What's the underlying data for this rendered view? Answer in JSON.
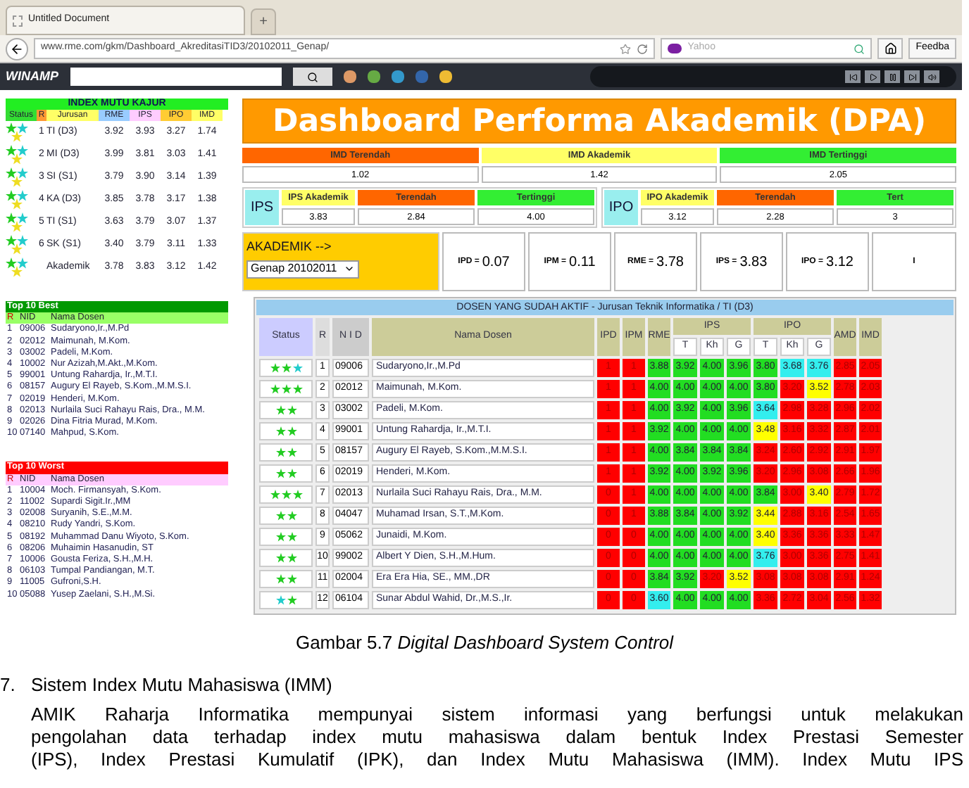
{
  "browser": {
    "tab_title": "Untitled Document",
    "new_tab": "+",
    "url": "www.rme.com/gkm/Dashboard_AkreditasiTID3/20102011_Genap/",
    "search_placeholder": "Yahoo",
    "feedback": "Feedba"
  },
  "toolbar": {
    "logo": "WINAMP"
  },
  "index_mutu": {
    "title": "INDEX MUTU KAJUR",
    "columns": [
      "Status",
      "R",
      "Jurusan",
      "RME",
      "IPS",
      "IPO",
      "IMD"
    ],
    "rows": [
      {
        "rank": "1",
        "jurusan": "TI (D3)",
        "values": [
          "3.92",
          "3.93",
          "3.27",
          "1.74"
        ]
      },
      {
        "rank": "2",
        "jurusan": "MI (D3)",
        "values": [
          "3.99",
          "3.81",
          "3.03",
          "1.41"
        ]
      },
      {
        "rank": "3",
        "jurusan": "SI (S1)",
        "values": [
          "3.79",
          "3.90",
          "3.14",
          "1.39"
        ]
      },
      {
        "rank": "4",
        "jurusan": "KA (D3)",
        "values": [
          "3.85",
          "3.78",
          "3.17",
          "1.38"
        ]
      },
      {
        "rank": "5",
        "jurusan": "TI (S1)",
        "values": [
          "3.63",
          "3.79",
          "3.07",
          "1.37"
        ]
      },
      {
        "rank": "6",
        "jurusan": "SK (S1)",
        "values": [
          "3.40",
          "3.79",
          "3.11",
          "1.33"
        ]
      },
      {
        "jurusan": "Akademik",
        "values": [
          "3.78",
          "3.83",
          "3.12",
          "1.42"
        ]
      }
    ]
  },
  "top_lists": [
    {
      "kind": "best",
      "title": "Top 10 Best",
      "columns": [
        "R",
        "NID",
        "Nama Dosen"
      ],
      "items": [
        {
          "rank": "1",
          "nid": "09006",
          "name": "Sudaryono,Ir.,M.Pd"
        },
        {
          "rank": "2",
          "nid": "02012",
          "name": "Maimunah, M.Kom."
        },
        {
          "rank": "3",
          "nid": "03002",
          "name": "Padeli, M.Kom."
        },
        {
          "rank": "4",
          "nid": "10002",
          "name": "Nur Azizah,M.Akt.,M.Kom."
        },
        {
          "rank": "5",
          "nid": "99001",
          "name": "Untung Rahardja, Ir.,M.T.I."
        },
        {
          "rank": "6",
          "nid": "08157",
          "name": "Augury El Rayeb, S.Kom.,M.M.S.I."
        },
        {
          "rank": "7",
          "nid": "02019",
          "name": "Henderi, M.Kom."
        },
        {
          "rank": "8",
          "nid": "02013",
          "name": "Nurlaila Suci Rahayu Rais, Dra., M.M."
        },
        {
          "rank": "9",
          "nid": "02026",
          "name": "Dina Fitria Murad, M.Kom."
        },
        {
          "rank": "10",
          "nid": "07140",
          "name": "Mahpud, S.Kom."
        }
      ]
    },
    {
      "kind": "worst",
      "title": "Top 10 Worst",
      "columns": [
        "R",
        "NID",
        "Nama Dosen"
      ],
      "items": [
        {
          "rank": "1",
          "nid": "10004",
          "name": "Moch. Firmansyah, S.Kom."
        },
        {
          "rank": "2",
          "nid": "11002",
          "name": "Supardi Sigit.Ir.,MM"
        },
        {
          "rank": "3",
          "nid": "02008",
          "name": "Suryanih, S.E.,M.M."
        },
        {
          "rank": "4",
          "nid": "08210",
          "name": "Rudy Yandri, S.Kom."
        },
        {
          "rank": "5",
          "nid": "08192",
          "name": "Muhammad Danu Wiyoto, S.Kom."
        },
        {
          "rank": "6",
          "nid": "08206",
          "name": "Muhaimin Hasanudin, ST"
        },
        {
          "rank": "7",
          "nid": "10006",
          "name": "Gousta Feriza, S.H.,M.H."
        },
        {
          "rank": "8",
          "nid": "06103",
          "name": "Tumpal Pandiangan, M.T."
        },
        {
          "rank": "9",
          "nid": "11005",
          "name": "Gufroni,S.H."
        },
        {
          "rank": "10",
          "nid": "05088",
          "name": "Yusep Zaelani, S.H.,M.Si."
        }
      ]
    }
  ],
  "dashboard": {
    "title": "Dashboard Performa Akademik (DPA)",
    "imd": [
      {
        "label": "IMD Terendah",
        "value": "1.02",
        "color": "#ff6600"
      },
      {
        "label": "IMD Akademik",
        "value": "1.42",
        "color": "#ffff66"
      },
      {
        "label": "IMD Tertinggi",
        "value": "2.05",
        "color": "#33ee33"
      }
    ],
    "groups": [
      {
        "label": "IPS",
        "cells": [
          {
            "label": "IPS Akademik",
            "value": "3.83",
            "color": "#ffff66"
          },
          {
            "label": "Terendah",
            "value": "2.84",
            "color": "#ff6600"
          },
          {
            "label": "Tertinggi",
            "value": "4.00",
            "color": "#33ee33"
          }
        ]
      },
      {
        "label": "IPO",
        "cells": [
          {
            "label": "IPO Akademik",
            "value": "3.12",
            "color": "#ffff66"
          },
          {
            "label": "Terendah",
            "value": "2.28",
            "color": "#ff6600"
          },
          {
            "label": "Tert",
            "value": "3",
            "color": "#33ee33"
          }
        ]
      }
    ],
    "period": {
      "label": "AKADEMIK -->",
      "value": "Genap 20102011"
    },
    "metrics": [
      {
        "label": "IPD =",
        "value": "0.07"
      },
      {
        "label": "IPM =",
        "value": "0.11"
      },
      {
        "label": "RME =",
        "value": "3.78"
      },
      {
        "label": "IPS =",
        "value": "3.83"
      },
      {
        "label": "IPO =",
        "value": "3.12"
      },
      {
        "label": "I"
      }
    ]
  },
  "table": {
    "title": "DOSEN YANG SUDAH AKTIF - Jurusan Teknik Informatika / TI (D3)",
    "columns": [
      {
        "label": "Status"
      },
      {
        "label": "R"
      },
      {
        "label": "N I D"
      },
      {
        "label": "Nama Dosen"
      },
      {
        "label": "IPD"
      },
      {
        "label": "IPM"
      },
      {
        "label": "RME"
      },
      {
        "label": "IPS",
        "colspan": 3,
        "sub": [
          "T",
          "Kh",
          "G"
        ]
      },
      {
        "label": "IPO",
        "colspan": 3,
        "sub": [
          "T",
          "Kh",
          "G"
        ]
      },
      {
        "label": "AMD"
      },
      {
        "label": "IMD"
      }
    ],
    "rows": [
      {
        "cells": [
          {
            "kind": "status",
            "icons": [
              {
                "color": "#22cc22"
              },
              {
                "color": "#22cc22"
              },
              {
                "color": "#22cccc"
              }
            ]
          },
          {
            "kind": "rank",
            "value": "1"
          },
          {
            "kind": "nid",
            "value": "09006"
          },
          {
            "kind": "name",
            "value": "Sudaryono,Ir.,M.Pd"
          },
          {
            "kind": "score",
            "value": "1",
            "color": "#ff0000"
          },
          {
            "kind": "score",
            "value": "1",
            "color": "#ff0000"
          },
          {
            "kind": "score",
            "value": "3.88",
            "color": "#22dd22"
          },
          {
            "kind": "score",
            "value": "3.92",
            "color": "#22dd22"
          },
          {
            "kind": "score",
            "value": "4.00",
            "color": "#22dd22"
          },
          {
            "kind": "score",
            "value": "3.96",
            "color": "#22dd22"
          },
          {
            "kind": "score",
            "value": "3.80",
            "color": "#22dd22"
          },
          {
            "kind": "score",
            "value": "3.68",
            "color": "#33eeee"
          },
          {
            "kind": "score",
            "value": "3.76",
            "color": "#33eeee"
          },
          {
            "kind": "score",
            "value": "2.85",
            "color": "#ff0000"
          },
          {
            "kind": "score",
            "value": "2.05",
            "color": "#ff0000"
          }
        ]
      },
      {
        "cells": [
          {
            "kind": "status",
            "icons": [
              {
                "color": "#22cc22"
              },
              {
                "color": "#22cc22"
              },
              {
                "color": "#22cc22"
              }
            ]
          },
          {
            "kind": "rank",
            "value": "2"
          },
          {
            "kind": "nid",
            "value": "02012"
          },
          {
            "kind": "name",
            "value": "Maimunah, M.Kom."
          },
          {
            "kind": "score",
            "value": "1",
            "color": "#ff0000"
          },
          {
            "kind": "score",
            "value": "1",
            "color": "#ff0000"
          },
          {
            "kind": "score",
            "value": "4.00",
            "color": "#22dd22"
          },
          {
            "kind": "score",
            "value": "4.00",
            "color": "#22dd22"
          },
          {
            "kind": "score",
            "value": "4.00",
            "color": "#22dd22"
          },
          {
            "kind": "score",
            "value": "4.00",
            "color": "#22dd22"
          },
          {
            "kind": "score",
            "value": "3.80",
            "color": "#22dd22"
          },
          {
            "kind": "score",
            "value": "3.20",
            "color": "#ff0000"
          },
          {
            "kind": "score",
            "value": "3.52",
            "color": "#ffff00"
          },
          {
            "kind": "score",
            "value": "2.78",
            "color": "#ff0000"
          },
          {
            "kind": "score",
            "value": "2.03",
            "color": "#ff0000"
          }
        ]
      },
      {
        "cells": [
          {
            "kind": "status",
            "icons": [
              {
                "color": "#22cc22"
              },
              {
                "color": "#22cc22"
              }
            ]
          },
          {
            "kind": "rank",
            "value": "3"
          },
          {
            "kind": "nid",
            "value": "03002"
          },
          {
            "kind": "name",
            "value": "Padeli, M.Kom."
          },
          {
            "kind": "score",
            "value": "1",
            "color": "#ff0000"
          },
          {
            "kind": "score",
            "value": "1",
            "color": "#ff0000"
          },
          {
            "kind": "score",
            "value": "4.00",
            "color": "#22dd22"
          },
          {
            "kind": "score",
            "value": "3.92",
            "color": "#22dd22"
          },
          {
            "kind": "score",
            "value": "4.00",
            "color": "#22dd22"
          },
          {
            "kind": "score",
            "value": "3.96",
            "color": "#22dd22"
          },
          {
            "kind": "score",
            "value": "3.64",
            "color": "#33eeee"
          },
          {
            "kind": "score",
            "value": "2.98",
            "color": "#ff0000"
          },
          {
            "kind": "score",
            "value": "3.28",
            "color": "#ff0000"
          },
          {
            "kind": "score",
            "value": "2.96",
            "color": "#ff0000"
          },
          {
            "kind": "score",
            "value": "2.02",
            "color": "#ff0000"
          }
        ]
      },
      {
        "cells": [
          {
            "kind": "status",
            "icons": [
              {
                "color": "#22cc22"
              },
              {
                "color": "#22cc22"
              }
            ]
          },
          {
            "kind": "rank",
            "value": "4"
          },
          {
            "kind": "nid",
            "value": "99001"
          },
          {
            "kind": "name",
            "value": "Untung Rahardja, Ir.,M.T.I."
          },
          {
            "kind": "score",
            "value": "1",
            "color": "#ff0000"
          },
          {
            "kind": "score",
            "value": "1",
            "color": "#ff0000"
          },
          {
            "kind": "score",
            "value": "3.92",
            "color": "#22dd22"
          },
          {
            "kind": "score",
            "value": "4.00",
            "color": "#22dd22"
          },
          {
            "kind": "score",
            "value": "4.00",
            "color": "#22dd22"
          },
          {
            "kind": "score",
            "value": "4.00",
            "color": "#22dd22"
          },
          {
            "kind": "score",
            "value": "3.48",
            "color": "#ffff00"
          },
          {
            "kind": "score",
            "value": "3.16",
            "color": "#ff0000"
          },
          {
            "kind": "score",
            "value": "3.32",
            "color": "#ff0000"
          },
          {
            "kind": "score",
            "value": "2.87",
            "color": "#ff0000"
          },
          {
            "kind": "score",
            "value": "2.01",
            "color": "#ff0000"
          }
        ]
      },
      {
        "cells": [
          {
            "kind": "status",
            "icons": [
              {
                "color": "#22cc22"
              },
              {
                "color": "#22cc22"
              }
            ]
          },
          {
            "kind": "rank",
            "value": "5"
          },
          {
            "kind": "nid",
            "value": "08157"
          },
          {
            "kind": "name",
            "value": "Augury El Rayeb, S.Kom.,M.M.S.I."
          },
          {
            "kind": "score",
            "value": "1",
            "color": "#ff0000"
          },
          {
            "kind": "score",
            "value": "1",
            "color": "#ff0000"
          },
          {
            "kind": "score",
            "value": "4.00",
            "color": "#22dd22"
          },
          {
            "kind": "score",
            "value": "3.84",
            "color": "#22dd22"
          },
          {
            "kind": "score",
            "value": "3.84",
            "color": "#22dd22"
          },
          {
            "kind": "score",
            "value": "3.84",
            "color": "#22dd22"
          },
          {
            "kind": "score",
            "value": "3.24",
            "color": "#ff0000"
          },
          {
            "kind": "score",
            "value": "2.60",
            "color": "#ff0000"
          },
          {
            "kind": "score",
            "value": "2.92",
            "color": "#ff0000"
          },
          {
            "kind": "score",
            "value": "2.91",
            "color": "#ff0000"
          },
          {
            "kind": "score",
            "value": "1.97",
            "color": "#ff0000"
          }
        ]
      },
      {
        "cells": [
          {
            "kind": "status",
            "icons": [
              {
                "color": "#22cc22"
              },
              {
                "color": "#22cc22"
              }
            ]
          },
          {
            "kind": "rank",
            "value": "6"
          },
          {
            "kind": "nid",
            "value": "02019"
          },
          {
            "kind": "name",
            "value": "Henderi, M.Kom."
          },
          {
            "kind": "score",
            "value": "1",
            "color": "#ff0000"
          },
          {
            "kind": "score",
            "value": "1",
            "color": "#ff0000"
          },
          {
            "kind": "score",
            "value": "3.92",
            "color": "#22dd22"
          },
          {
            "kind": "score",
            "value": "4.00",
            "color": "#22dd22"
          },
          {
            "kind": "score",
            "value": "3.92",
            "color": "#22dd22"
          },
          {
            "kind": "score",
            "value": "3.96",
            "color": "#22dd22"
          },
          {
            "kind": "score",
            "value": "3.20",
            "color": "#ff0000"
          },
          {
            "kind": "score",
            "value": "2.96",
            "color": "#ff0000"
          },
          {
            "kind": "score",
            "value": "3.08",
            "color": "#ff0000"
          },
          {
            "kind": "score",
            "value": "2.66",
            "color": "#ff0000"
          },
          {
            "kind": "score",
            "value": "1.96",
            "color": "#ff0000"
          }
        ]
      },
      {
        "cells": [
          {
            "kind": "status",
            "icons": [
              {
                "color": "#22cc22"
              },
              {
                "color": "#22cc22"
              },
              {
                "color": "#22cc22"
              }
            ]
          },
          {
            "kind": "rank",
            "value": "7"
          },
          {
            "kind": "nid",
            "value": "02013"
          },
          {
            "kind": "name",
            "value": "Nurlaila Suci Rahayu Rais, Dra., M.M."
          },
          {
            "kind": "score",
            "value": "0",
            "color": "#ff0000"
          },
          {
            "kind": "score",
            "value": "1",
            "color": "#ff0000"
          },
          {
            "kind": "score",
            "value": "4.00",
            "color": "#22dd22"
          },
          {
            "kind": "score",
            "value": "4.00",
            "color": "#22dd22"
          },
          {
            "kind": "score",
            "value": "4.00",
            "color": "#22dd22"
          },
          {
            "kind": "score",
            "value": "4.00",
            "color": "#22dd22"
          },
          {
            "kind": "score",
            "value": "3.84",
            "color": "#22dd22"
          },
          {
            "kind": "score",
            "value": "3.00",
            "color": "#ff0000"
          },
          {
            "kind": "score",
            "value": "3.40",
            "color": "#ffff00"
          },
          {
            "kind": "score",
            "value": "2.79",
            "color": "#ff0000"
          },
          {
            "kind": "score",
            "value": "1.72",
            "color": "#ff0000"
          }
        ]
      },
      {
        "cells": [
          {
            "kind": "status",
            "icons": [
              {
                "color": "#22cc22"
              },
              {
                "color": "#22cc22"
              }
            ]
          },
          {
            "kind": "rank",
            "value": "8"
          },
          {
            "kind": "nid",
            "value": "04047"
          },
          {
            "kind": "name",
            "value": "Muhamad Irsan, S.T.,M.Kom."
          },
          {
            "kind": "score",
            "value": "0",
            "color": "#ff0000"
          },
          {
            "kind": "score",
            "value": "1",
            "color": "#ff0000"
          },
          {
            "kind": "score",
            "value": "3.88",
            "color": "#22dd22"
          },
          {
            "kind": "score",
            "value": "3.84",
            "color": "#22dd22"
          },
          {
            "kind": "score",
            "value": "4.00",
            "color": "#22dd22"
          },
          {
            "kind": "score",
            "value": "3.92",
            "color": "#22dd22"
          },
          {
            "kind": "score",
            "value": "3.44",
            "color": "#ffff00"
          },
          {
            "kind": "score",
            "value": "2.88",
            "color": "#ff0000"
          },
          {
            "kind": "score",
            "value": "3.16",
            "color": "#ff0000"
          },
          {
            "kind": "score",
            "value": "2.54",
            "color": "#ff0000"
          },
          {
            "kind": "score",
            "value": "1.65",
            "color": "#ff0000"
          }
        ]
      },
      {
        "cells": [
          {
            "kind": "status",
            "icons": [
              {
                "color": "#22cc22"
              },
              {
                "color": "#22cc22"
              }
            ]
          },
          {
            "kind": "rank",
            "value": "9"
          },
          {
            "kind": "nid",
            "value": "05062"
          },
          {
            "kind": "name",
            "value": "Junaidi, M.Kom."
          },
          {
            "kind": "score",
            "value": "0",
            "color": "#ff0000"
          },
          {
            "kind": "score",
            "value": "0",
            "color": "#ff0000"
          },
          {
            "kind": "score",
            "value": "4.00",
            "color": "#22dd22"
          },
          {
            "kind": "score",
            "value": "4.00",
            "color": "#22dd22"
          },
          {
            "kind": "score",
            "value": "4.00",
            "color": "#22dd22"
          },
          {
            "kind": "score",
            "value": "4.00",
            "color": "#22dd22"
          },
          {
            "kind": "score",
            "value": "3.40",
            "color": "#ffff00"
          },
          {
            "kind": "score",
            "value": "3.36",
            "color": "#ff0000"
          },
          {
            "kind": "score",
            "value": "3.36",
            "color": "#ff0000"
          },
          {
            "kind": "score",
            "value": "3.33",
            "color": "#ff0000"
          },
          {
            "kind": "score",
            "value": "1.47",
            "color": "#ff0000"
          }
        ]
      },
      {
        "cells": [
          {
            "kind": "status",
            "icons": [
              {
                "color": "#22cc22"
              },
              {
                "color": "#22cc22"
              }
            ]
          },
          {
            "kind": "rank",
            "value": "10"
          },
          {
            "kind": "nid",
            "value": "99002"
          },
          {
            "kind": "name",
            "value": "Albert Y Dien, S.H.,M.Hum."
          },
          {
            "kind": "score",
            "value": "0",
            "color": "#ff0000"
          },
          {
            "kind": "score",
            "value": "0",
            "color": "#ff0000"
          },
          {
            "kind": "score",
            "value": "4.00",
            "color": "#22dd22"
          },
          {
            "kind": "score",
            "value": "4.00",
            "color": "#22dd22"
          },
          {
            "kind": "score",
            "value": "4.00",
            "color": "#22dd22"
          },
          {
            "kind": "score",
            "value": "4.00",
            "color": "#22dd22"
          },
          {
            "kind": "score",
            "value": "3.76",
            "color": "#33eeee"
          },
          {
            "kind": "score",
            "value": "3.00",
            "color": "#ff0000"
          },
          {
            "kind": "score",
            "value": "3.36",
            "color": "#ff0000"
          },
          {
            "kind": "score",
            "value": "2.75",
            "color": "#ff0000"
          },
          {
            "kind": "score",
            "value": "1.41",
            "color": "#ff0000"
          }
        ]
      },
      {
        "cells": [
          {
            "kind": "status",
            "icons": [
              {
                "color": "#22cc22"
              },
              {
                "color": "#22cc22"
              }
            ]
          },
          {
            "kind": "rank",
            "value": "11"
          },
          {
            "kind": "nid",
            "value": "02004"
          },
          {
            "kind": "name",
            "value": "Era Era Hia, SE., MM.,DR"
          },
          {
            "kind": "score",
            "value": "0",
            "color": "#ff0000"
          },
          {
            "kind": "score",
            "value": "0",
            "color": "#ff0000"
          },
          {
            "kind": "score",
            "value": "3.84",
            "color": "#22dd22"
          },
          {
            "kind": "score",
            "value": "3.92",
            "color": "#22dd22"
          },
          {
            "kind": "score",
            "value": "3.20",
            "color": "#ff0000"
          },
          {
            "kind": "score",
            "value": "3.52",
            "color": "#ffff00"
          },
          {
            "kind": "score",
            "value": "3.08",
            "color": "#ff0000"
          },
          {
            "kind": "score",
            "value": "3.08",
            "color": "#ff0000"
          },
          {
            "kind": "score",
            "value": "3.08",
            "color": "#ff0000"
          },
          {
            "kind": "score",
            "value": "2.91",
            "color": "#ff0000"
          },
          {
            "kind": "score",
            "value": "1.24",
            "color": "#ff0000"
          }
        ]
      },
      {
        "cells": [
          {
            "kind": "status",
            "icons": [
              {
                "color": "#22cccc"
              },
              {
                "color": "#22cc22"
              }
            ]
          },
          {
            "kind": "rank",
            "value": "12"
          },
          {
            "kind": "nid",
            "value": "06104"
          },
          {
            "kind": "name",
            "value": "Sunar Abdul Wahid, Dr.,M.S.,Ir."
          },
          {
            "kind": "score",
            "value": "0",
            "color": "#ff0000"
          },
          {
            "kind": "score",
            "value": "0",
            "color": "#ff0000"
          },
          {
            "kind": "score",
            "value": "3.60",
            "color": "#33eeee"
          },
          {
            "kind": "score",
            "value": "4.00",
            "color": "#22dd22"
          },
          {
            "kind": "score",
            "value": "4.00",
            "color": "#22dd22"
          },
          {
            "kind": "score",
            "value": "4.00",
            "color": "#22dd22"
          },
          {
            "kind": "score",
            "value": "3.36",
            "color": "#ff0000"
          },
          {
            "kind": "score",
            "value": "2.72",
            "color": "#ff0000"
          },
          {
            "kind": "score",
            "value": "3.04",
            "color": "#ff0000"
          },
          {
            "kind": "score",
            "value": "2.56",
            "color": "#ff0000"
          },
          {
            "kind": "score",
            "value": "1.32",
            "color": "#ff0000"
          }
        ]
      }
    ]
  },
  "document": {
    "caption_number": "Gambar 5.7",
    "caption_title": "Digital Dashboard System Control",
    "section_number": "7.",
    "section_title": "Sistem Index Mutu Mahasiswa (IMM)",
    "lines": [
      "AMIK Raharja Informatika mempunyai sistem informasi yang berfungsi untuk melakukan",
      "pengolahan data terhadap index mutu mahasiswa dalam bentuk Index Prestasi Semester",
      "(IPS), Index Prestasi Kumulatif (IPK), dan Index Mutu Mahasiswa (IMM). Index Mutu IPS"
    ]
  }
}
